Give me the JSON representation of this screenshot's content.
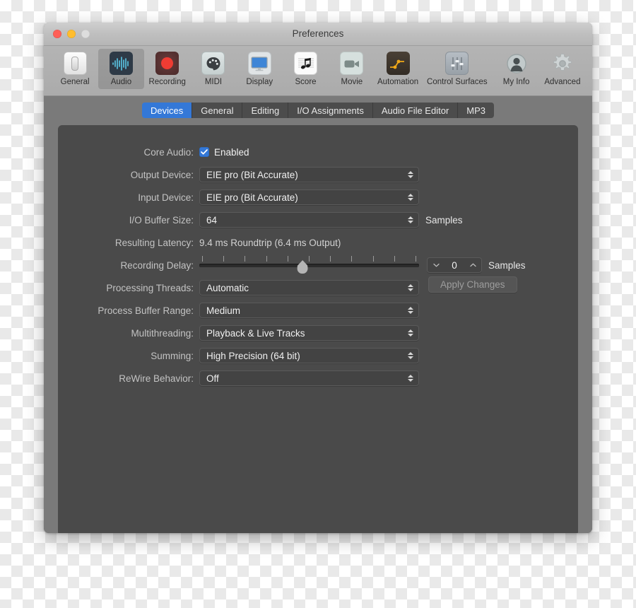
{
  "window": {
    "title": "Preferences",
    "traffic_lights": [
      "close-red",
      "minimize-yellow",
      "zoom-gray-disabled"
    ]
  },
  "toolbar": {
    "items": [
      {
        "label": "General",
        "icon": "general-slider-icon"
      },
      {
        "label": "Audio",
        "icon": "audio-waveform-icon",
        "selected": true
      },
      {
        "label": "Recording",
        "icon": "record-dot-icon"
      },
      {
        "label": "MIDI",
        "icon": "midi-palette-icon"
      },
      {
        "label": "Display",
        "icon": "display-monitor-icon"
      },
      {
        "label": "Score",
        "icon": "score-note-icon"
      },
      {
        "label": "Movie",
        "icon": "movie-camera-icon"
      },
      {
        "label": "Automation",
        "icon": "automation-curve-icon"
      },
      {
        "label": "Control Surfaces",
        "icon": "control-surfaces-faders-icon"
      },
      {
        "label": "My Info",
        "icon": "my-info-person-icon"
      },
      {
        "label": "Advanced",
        "icon": "advanced-gear-icon"
      }
    ]
  },
  "tabs": [
    {
      "label": "Devices",
      "active": true
    },
    {
      "label": "General",
      "active": false
    },
    {
      "label": "Editing",
      "active": false
    },
    {
      "label": "I/O Assignments",
      "active": false
    },
    {
      "label": "Audio File Editor",
      "active": false
    },
    {
      "label": "MP3",
      "active": false
    }
  ],
  "form": {
    "core_audio": {
      "label": "Core Audio:",
      "checkbox_label": "Enabled",
      "checked": true
    },
    "output_device": {
      "label": "Output Device:",
      "value": "EIE pro (Bit Accurate)"
    },
    "input_device": {
      "label": "Input Device:",
      "value": "EIE pro (Bit Accurate)"
    },
    "io_buffer_size": {
      "label": "I/O Buffer Size:",
      "value": "64",
      "unit": "Samples"
    },
    "resulting_latency": {
      "label": "Resulting Latency:",
      "value": "9.4 ms Roundtrip (6.4 ms Output)"
    },
    "recording_delay": {
      "label": "Recording Delay:",
      "value": "0",
      "unit": "Samples",
      "tick_count": 11,
      "thumb_position_percent": 47,
      "decrement_icon": "chevron-down-icon",
      "increment_icon": "chevron-up-icon"
    },
    "processing_threads": {
      "label": "Processing Threads:",
      "value": "Automatic"
    },
    "process_buffer_range": {
      "label": "Process Buffer Range:",
      "value": "Medium"
    },
    "multithreading": {
      "label": "Multithreading:",
      "value": "Playback & Live Tracks"
    },
    "summing": {
      "label": "Summing:",
      "value": "High Precision (64 bit)"
    },
    "rewire_behavior": {
      "label": "ReWire Behavior:",
      "value": "Off"
    },
    "apply_button": {
      "label": "Apply Changes",
      "enabled": false
    }
  },
  "colors": {
    "accent_blue": "#3478d7",
    "window_chrome": "#b4b4b4",
    "content_bg": "#7a7a7a",
    "panel_bg": "#4a4a4a",
    "field_bg": "#434343",
    "label_text": "#c3c3c3",
    "value_text": "#f0f0f0",
    "traffic_red": "#ff5f57",
    "traffic_yellow": "#ffbd2e",
    "traffic_gray": "#dddddd"
  }
}
